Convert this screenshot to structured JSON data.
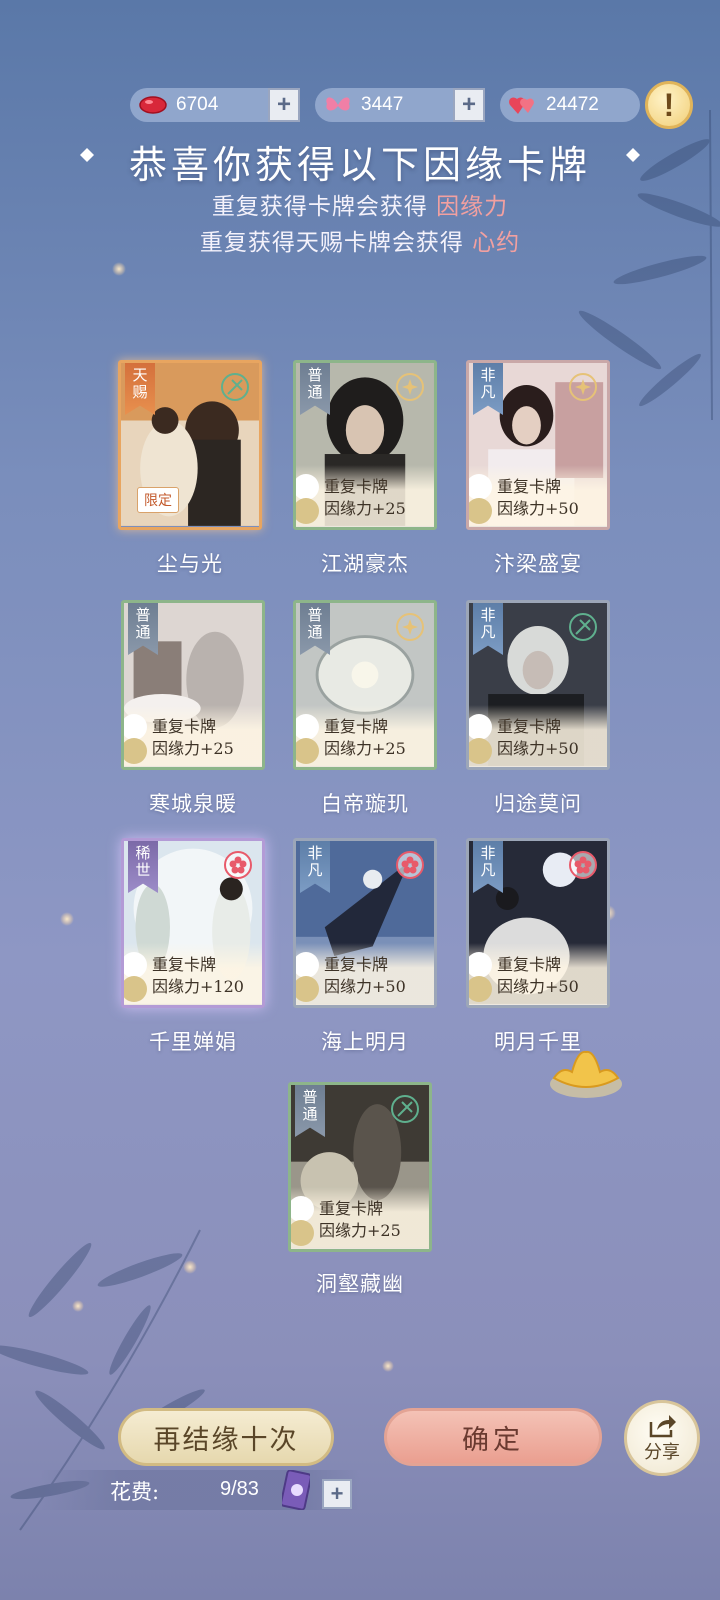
{
  "currencies": [
    {
      "name": "red-bean",
      "value": "6704",
      "icon": "red-bean-icon",
      "color": "#d8283a"
    },
    {
      "name": "butterfly",
      "value": "3447",
      "icon": "butterfly-icon",
      "color": "#f07fa6"
    },
    {
      "name": "hearts",
      "value": "24472",
      "icon": "hearts-icon",
      "color": "#e8455a"
    }
  ],
  "info_label": "!",
  "title": "恭喜你获得以下因缘卡牌",
  "subtitle1": {
    "text": "重复获得卡牌会获得 ",
    "highlight": "因缘力"
  },
  "subtitle2": {
    "text": "重复获得天赐卡牌会获得 ",
    "highlight": "心约"
  },
  "cards": [
    {
      "name": "尘与光",
      "rarity": "天赐",
      "repeat": "",
      "bonus": "",
      "limited": "限定"
    },
    {
      "name": "江湖豪杰",
      "rarity": "普通",
      "repeat": "重复卡牌",
      "bonus": "因缘力+25"
    },
    {
      "name": "汴梁盛宴",
      "rarity": "非凡",
      "repeat": "重复卡牌",
      "bonus": "因缘力+50"
    },
    {
      "name": "寒城泉暖",
      "rarity": "普通",
      "repeat": "重复卡牌",
      "bonus": "因缘力+25"
    },
    {
      "name": "白帝璇玑",
      "rarity": "普通",
      "repeat": "重复卡牌",
      "bonus": "因缘力+25"
    },
    {
      "name": "归途莫问",
      "rarity": "非凡",
      "repeat": "重复卡牌",
      "bonus": "因缘力+50"
    },
    {
      "name": "千里婵娟",
      "rarity": "稀世",
      "repeat": "重复卡牌",
      "bonus": "因缘力+120"
    },
    {
      "name": "海上明月",
      "rarity": "非凡",
      "repeat": "重复卡牌",
      "bonus": "因缘力+50"
    },
    {
      "name": "明月千里",
      "rarity": "非凡",
      "repeat": "重复卡牌",
      "bonus": "因缘力+50"
    },
    {
      "name": "洞壑藏幽",
      "rarity": "普通",
      "repeat": "重复卡牌",
      "bonus": "因缘力+25"
    }
  ],
  "buttons": {
    "again": "再结缘十次",
    "confirm": "确定",
    "share": "分享"
  },
  "cost": {
    "label": "花费:",
    "value": "9/83"
  },
  "plus": "+"
}
